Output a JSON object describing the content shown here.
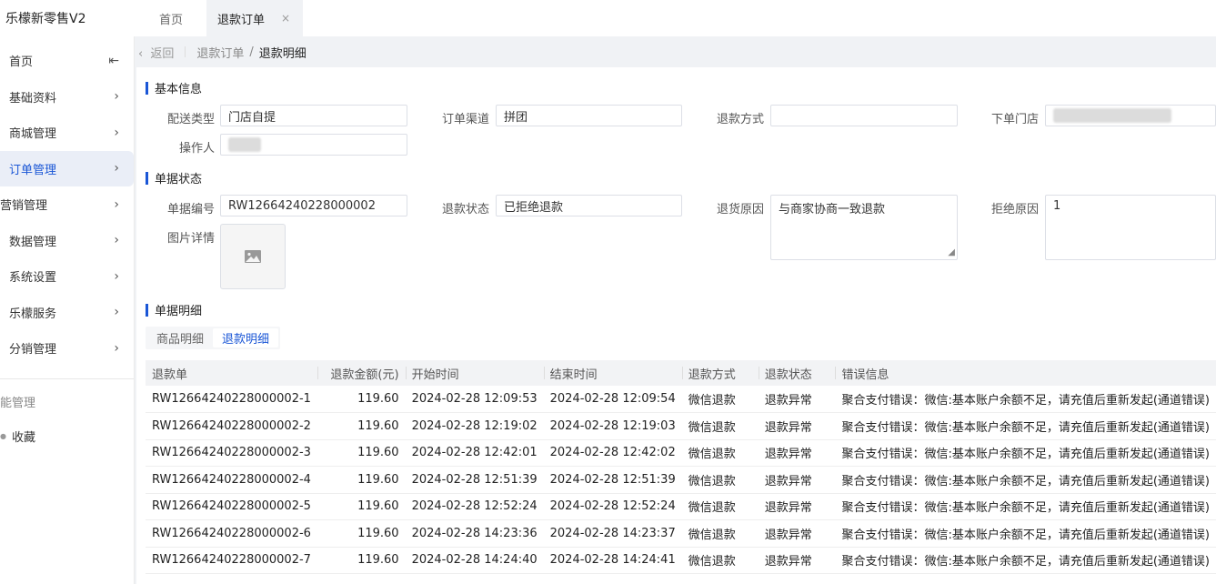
{
  "app": {
    "title": "乐檬新零售V2"
  },
  "tabs": [
    {
      "label": "首页"
    },
    {
      "label": "退款订单",
      "close": "×"
    }
  ],
  "sidebar": {
    "collapse_icon": "collapse-left-icon",
    "items": [
      {
        "label": "首页"
      },
      {
        "label": "基础资料"
      },
      {
        "label": "商城管理"
      },
      {
        "label": "订单管理"
      },
      {
        "label": "营销管理"
      },
      {
        "label": "数据管理"
      },
      {
        "label": "系统设置"
      },
      {
        "label": "乐檬服务"
      },
      {
        "label": "分销管理"
      }
    ],
    "extra": [
      {
        "label": "能管理"
      },
      {
        "label": "收藏"
      }
    ],
    "active_color": "#1a56d6"
  },
  "breadcrumb": {
    "back": "返回",
    "parent": "退款订单",
    "separator": "/",
    "current": "退款明细"
  },
  "basic_info": {
    "title": "基本信息",
    "delivery_type_label": "配送类型",
    "delivery_type_value": "门店自提",
    "channel_label": "订单渠道",
    "channel_value": "拼团",
    "refund_method_label": "退款方式",
    "refund_method_value": "",
    "store_label": "下单门店",
    "operator_label": "操作人"
  },
  "status": {
    "title": "单据状态",
    "doc_no_label": "单据编号",
    "doc_no_value": "RW12664240228000002",
    "refund_status_label": "退款状态",
    "refund_status_value": "已拒绝退款",
    "return_reason_label": "退货原因",
    "return_reason_value": "与商家协商一致退款",
    "reject_reason_label": "拒绝原因",
    "reject_reason_value": "1",
    "image_label": "图片详情",
    "image_icon": "image-placeholder-icon"
  },
  "detail": {
    "title": "单据明细",
    "subtabs": [
      {
        "label": "商品明细"
      },
      {
        "label": "退款明细",
        "active": true
      }
    ],
    "columns": [
      "退款单",
      "退款金额(元)",
      "开始时间",
      "结束时间",
      "退款方式",
      "退款状态",
      "错误信息"
    ],
    "rows": [
      [
        "RW12664240228000002-1",
        "119.60",
        "2024-02-28 12:09:53",
        "2024-02-28 12:09:54",
        "微信退款",
        "退款异常",
        "聚合支付错误：微信:基本账户余额不足，请充值后重新发起(通道错误)"
      ],
      [
        "RW12664240228000002-2",
        "119.60",
        "2024-02-28 12:19:02",
        "2024-02-28 12:19:03",
        "微信退款",
        "退款异常",
        "聚合支付错误：微信:基本账户余额不足，请充值后重新发起(通道错误)"
      ],
      [
        "RW12664240228000002-3",
        "119.60",
        "2024-02-28 12:42:01",
        "2024-02-28 12:42:02",
        "微信退款",
        "退款异常",
        "聚合支付错误：微信:基本账户余额不足，请充值后重新发起(通道错误)"
      ],
      [
        "RW12664240228000002-4",
        "119.60",
        "2024-02-28 12:51:39",
        "2024-02-28 12:51:39",
        "微信退款",
        "退款异常",
        "聚合支付错误：微信:基本账户余额不足，请充值后重新发起(通道错误)"
      ],
      [
        "RW12664240228000002-5",
        "119.60",
        "2024-02-28 12:52:24",
        "2024-02-28 12:52:24",
        "微信退款",
        "退款异常",
        "聚合支付错误：微信:基本账户余额不足，请充值后重新发起(通道错误)"
      ],
      [
        "RW12664240228000002-6",
        "119.60",
        "2024-02-28 14:23:36",
        "2024-02-28 14:23:37",
        "微信退款",
        "退款异常",
        "聚合支付错误：微信:基本账户余额不足，请充值后重新发起(通道错误)"
      ],
      [
        "RW12664240228000002-7",
        "119.60",
        "2024-02-28 14:24:40",
        "2024-02-28 14:24:41",
        "微信退款",
        "退款异常",
        "聚合支付错误：微信:基本账户余额不足，请充值后重新发起(通道错误)"
      ]
    ]
  },
  "colors": {
    "accent": "#1a56d6",
    "background": "#f0f2f5"
  }
}
